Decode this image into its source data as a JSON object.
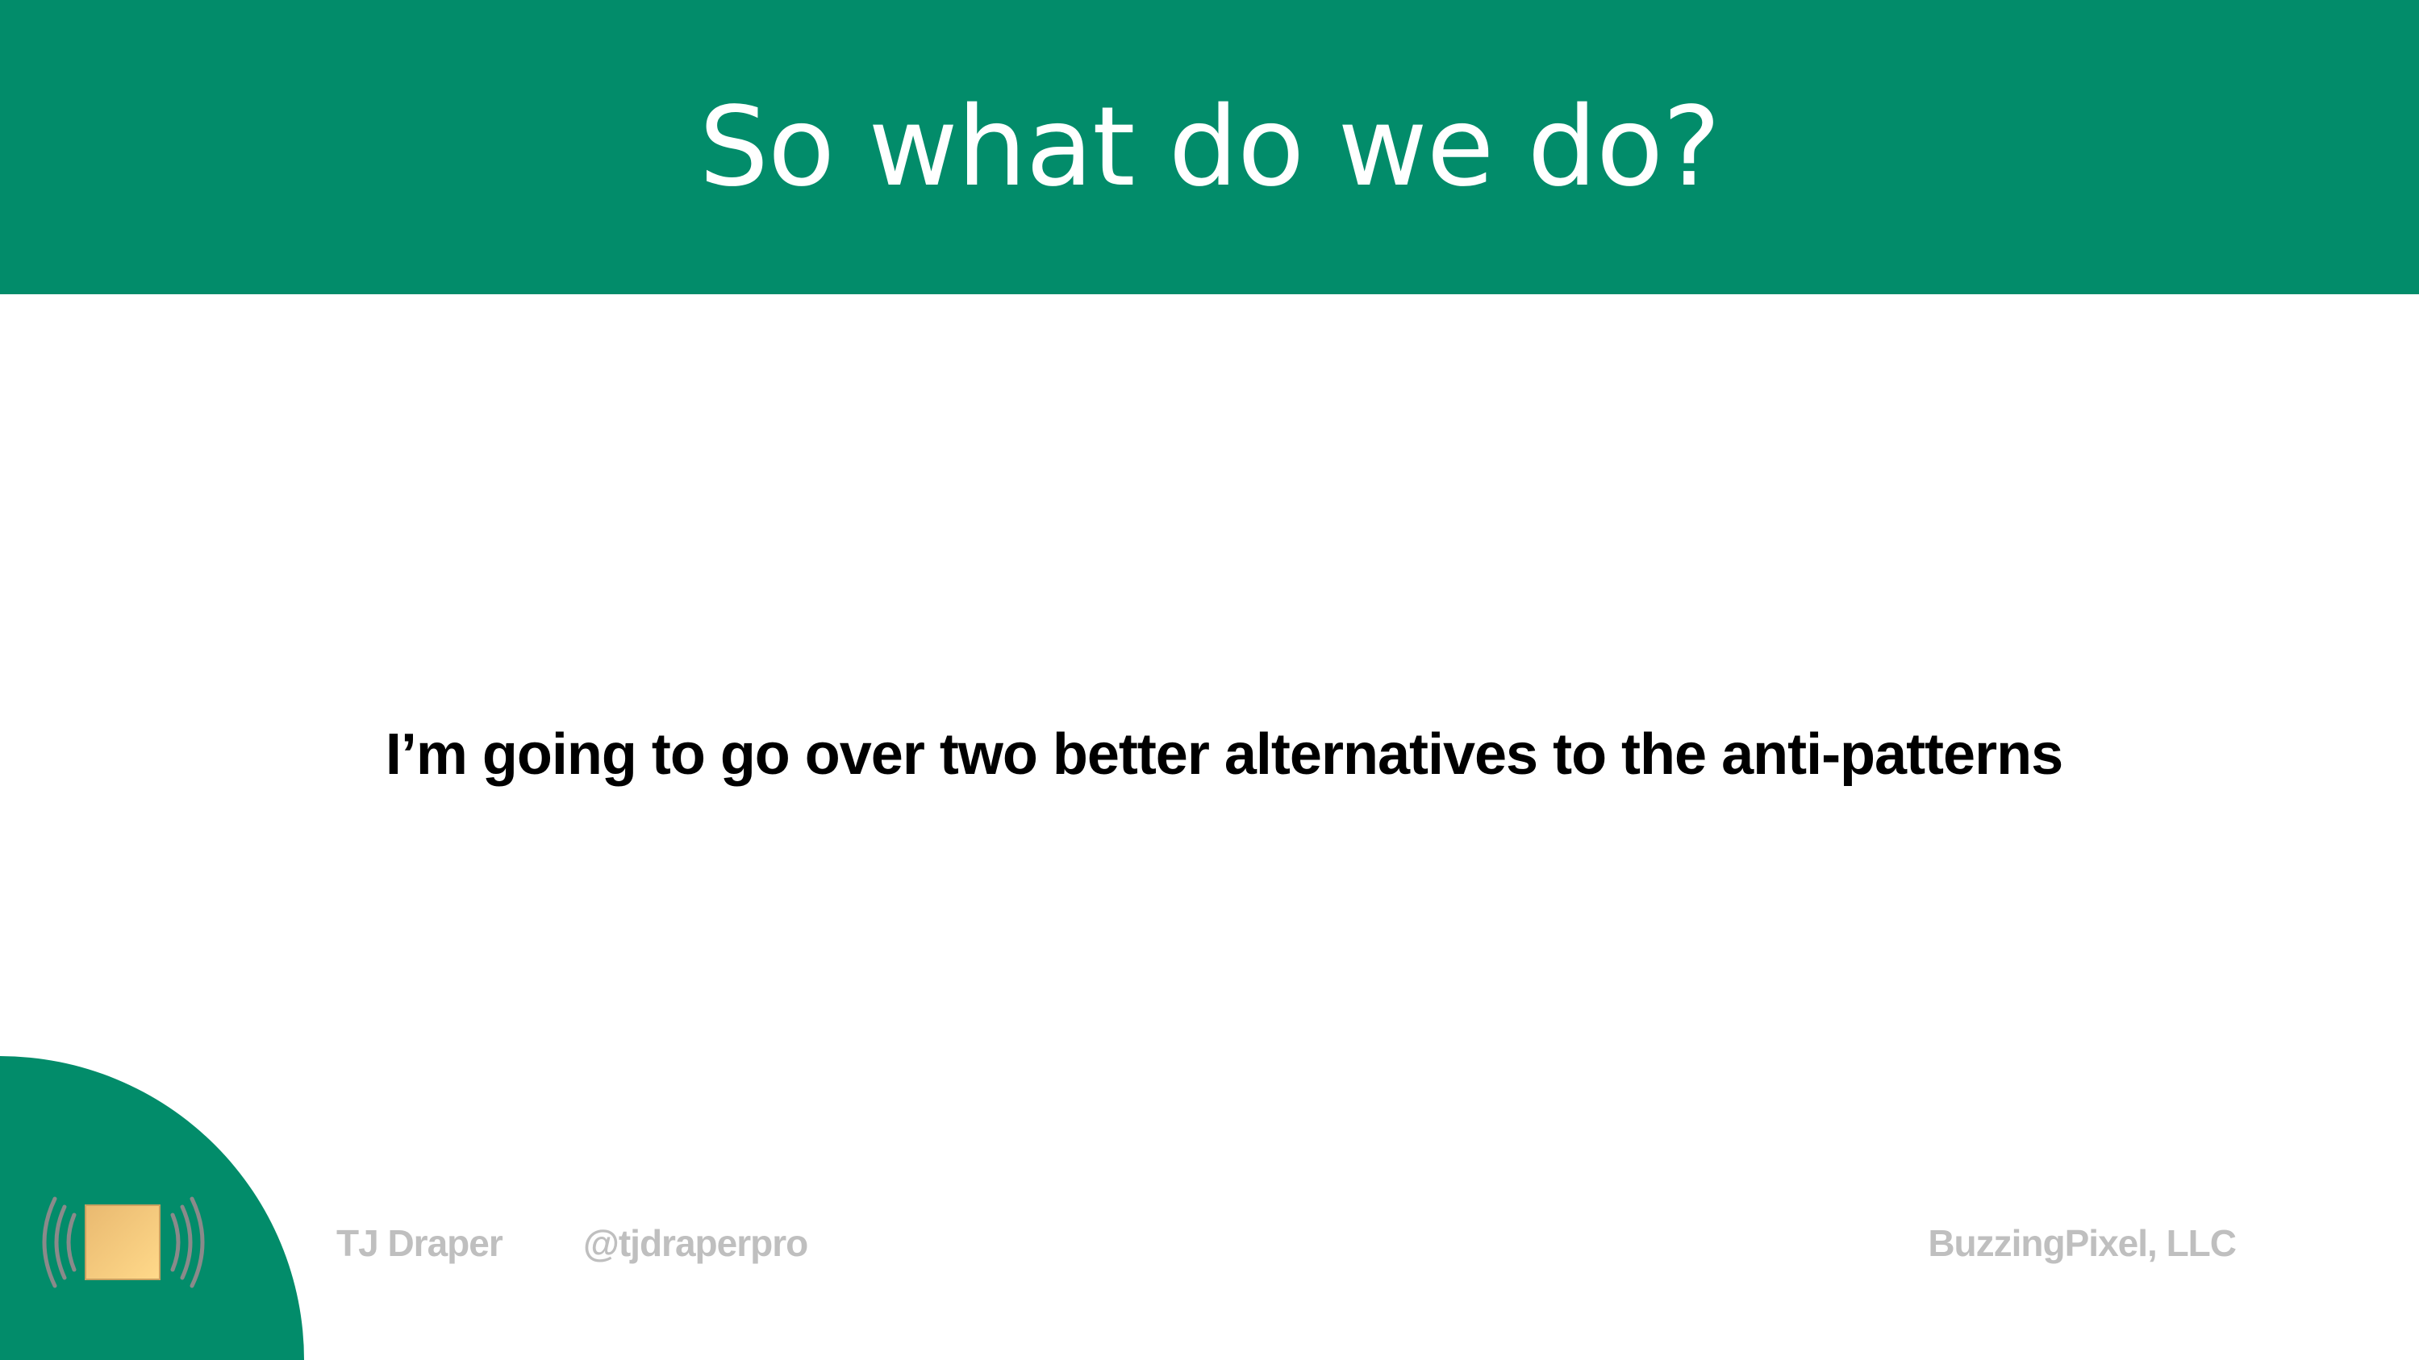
{
  "slide": {
    "title": "So what do we do?",
    "body": "I’m going to go over two better alternatives to the anti-patterns"
  },
  "footer": {
    "author": "TJ Draper",
    "handle": "@tjdraperpro",
    "company": "BuzzingPixel, LLC",
    "logo_icon": "buzzing-pixel-logo-icon"
  },
  "colors": {
    "brand_green": "#028c6a",
    "footer_text": "#bfbfbf",
    "logo_gold": "#f2c77a"
  }
}
